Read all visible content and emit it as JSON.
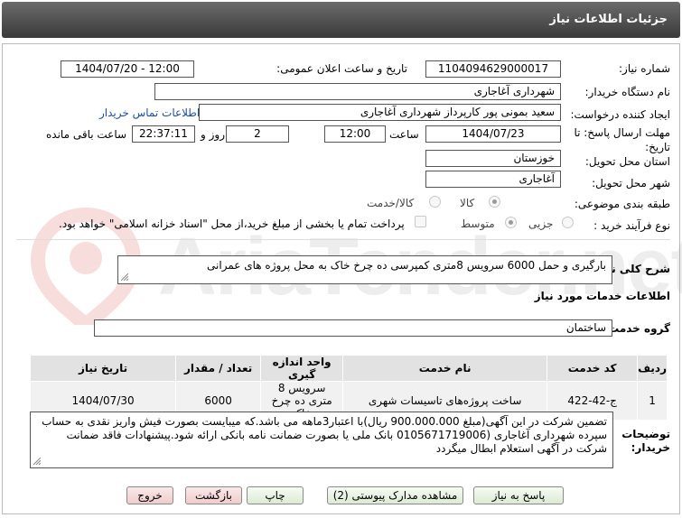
{
  "header": {
    "title": "جزئیات اطلاعات نیاز"
  },
  "watermark": {
    "text": "AriaTender.net"
  },
  "form": {
    "need_number": {
      "label": "شماره نیاز:",
      "value": "1104094629000017"
    },
    "announce": {
      "label": "تاریخ و ساعت اعلان عمومی:",
      "value": "1404/07/20 - 12:00"
    },
    "buyer": {
      "label": "نام دستگاه خریدار:",
      "value": "شهرداری آغاجاری"
    },
    "creator": {
      "label": "ایجاد کننده درخواست:",
      "value": "سعید بمونی پور کارپرداز شهرداری آغاجاری",
      "contact_link": "اطلاعات تماس خریدار"
    },
    "deadline": {
      "label": "مهلت ارسال پاسخ: تا تاریخ:",
      "date": "1404/07/23",
      "time_label": "ساعت",
      "time": "12:00",
      "days": "2",
      "days_label": "روز و",
      "remaining": "22:37:11",
      "remaining_label": "ساعت باقی مانده"
    },
    "province": {
      "label": "استان محل تحویل:",
      "value": "خوزستان"
    },
    "city": {
      "label": "شهر محل تحویل:",
      "value": "آغاجاری"
    },
    "category": {
      "label": "طبقه بندی موضوعی:",
      "options": [
        "کالا",
        "کالا/خدمت"
      ]
    },
    "process": {
      "label": "نوع فرآیند خرید :",
      "options": [
        "جزیی",
        "متوسط"
      ],
      "note": "پرداخت تمام یا بخشی از مبلغ خرید،از محل \"اسناد خزانه اسلامی\" خواهد بود."
    },
    "general_desc": {
      "label": "شرح کلی نیاز:",
      "value": "بارگیری و حمل  6000 سرویس 8متری کمپرسی ده چرخ خاک به محل پروژه های عمرانی"
    },
    "services_title": "اطلاعات خدمات مورد نیاز",
    "service_group": {
      "label": "گروه خدمت:",
      "value": "ساختمان"
    }
  },
  "table": {
    "headers": [
      "ردیف",
      "کد خدمت",
      "نام خدمت",
      "واحد اندازه گیری",
      "تعداد / مقدار",
      "تاریخ نیاز"
    ],
    "rows": [
      [
        "1",
        "ج-42-422",
        "ساخت پروژه‌های تاسیسات شهری",
        "سرویس 8 متری ده چرخ خاک",
        "6000",
        "1404/07/30"
      ]
    ]
  },
  "buyer_notes": {
    "label": "توضیحات خریدار:",
    "value": "تضمین شرکت در این آگهی(مبلغ 900.000.000 ریال)با اعتبار3ماهه می باشد.که میبایست بصورت فیش واریز نقدی به حساب سپرده شهرداری آغاجاری  (0105671719006 بانک ملی  یا بصورت ضمانت نامه بانکی  ارائه شود.پیشنهادات فاقد ضمانت شرکت در آگهی استعلام ابطال میگردد"
  },
  "buttons": {
    "respond": "پاسخ به نیاز",
    "docs": "مشاهده مدارک پیوستی (2)",
    "print": "چاپ",
    "back": "بازگشت",
    "exit": "خروج"
  }
}
